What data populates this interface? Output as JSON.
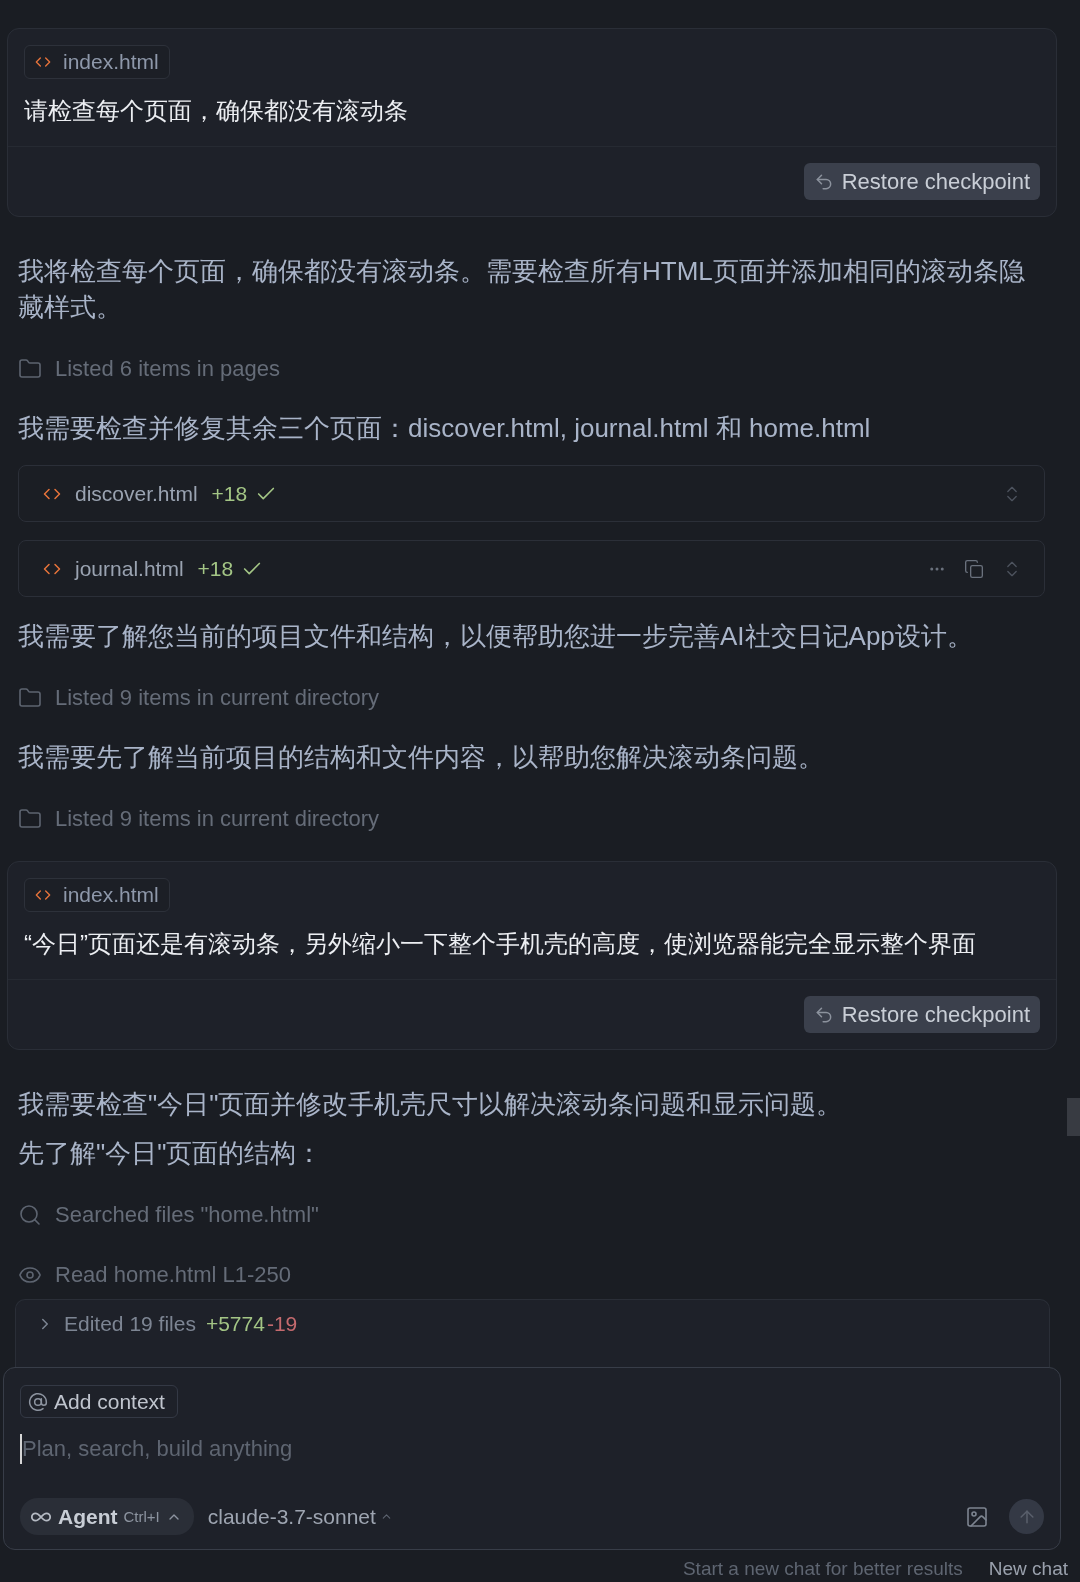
{
  "conversation": [
    {
      "kind": "user_message",
      "attachment": "index.html",
      "text": "请检查每个页面，确保都没有滚动条",
      "button": "Restore checkpoint"
    },
    {
      "kind": "paragraph",
      "text": "我将检查每个页面，确保都没有滚动条。需要检查所有HTML页面并添加相同的滚动条隐藏样式。"
    },
    {
      "kind": "listing",
      "text": "Listed 6 items in pages"
    },
    {
      "kind": "paragraph",
      "text": "我需要检查并修复其余三个页面：discover.html, journal.html 和 home.html"
    },
    {
      "kind": "file_edit",
      "file": "discover.html",
      "added": "+18",
      "applied": true,
      "hovered": false
    },
    {
      "kind": "file_edit",
      "file": "journal.html",
      "added": "+18",
      "applied": true,
      "hovered": true
    },
    {
      "kind": "paragraph",
      "text": "我需要了解您当前的项目文件和结构，以便帮助您进一步完善AI社交日记App设计。"
    },
    {
      "kind": "listing",
      "text": "Listed 9 items in current directory"
    },
    {
      "kind": "paragraph",
      "text": "我需要先了解当前项目的结构和文件内容，以帮助您解决滚动条问题。"
    },
    {
      "kind": "listing",
      "text": "Listed 9 items in current directory"
    },
    {
      "kind": "user_message",
      "attachment": "index.html",
      "text": "“今日”页面还是有滚动条，另外缩小一下整个手机壳的高度，使浏览器能完全显示整个界面",
      "button": "Restore checkpoint"
    },
    {
      "kind": "paragraph",
      "text": "我需要检查\"今日\"页面并修改手机壳尺寸以解决滚动条问题和显示问题。"
    },
    {
      "kind": "paragraph",
      "text": "先了解\"今日\"页面的结构："
    },
    {
      "kind": "search",
      "text": "Searched files \"home.html\""
    },
    {
      "kind": "read",
      "text": "Read home.html L1-250"
    }
  ],
  "edits_summary": {
    "text": "Edited 19 files",
    "added": "+5774",
    "removed": "-19",
    "expanded": false
  },
  "composer": {
    "context_button": "Add context",
    "placeholder": "Plan, search, build anything",
    "mode": "Agent",
    "shortcut": "Ctrl+I",
    "model": "claude-3.7-sonnet"
  },
  "hint": {
    "text": "Start a new chat for better results",
    "link": "New chat"
  }
}
